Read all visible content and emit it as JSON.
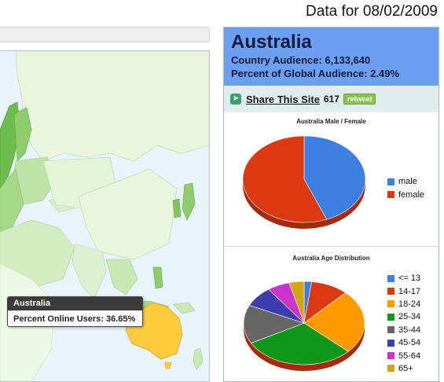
{
  "header": {
    "date_label": "Data for 08/02/2009"
  },
  "map": {
    "tooltip": {
      "title": "Australia",
      "value_label": "Percent Online Users: 36.65%"
    }
  },
  "panel": {
    "country": "Australia",
    "audience_line": "Country Audience: 6,133,640",
    "percent_line": "Percent of Global Audience: 2.49%",
    "share_label": "Share This Site",
    "share_count": "617",
    "retweet_label": "retweet"
  },
  "chart_data": [
    {
      "type": "pie",
      "title": "Australia Male / Female",
      "categories": [
        "male",
        "female"
      ],
      "values": [
        44,
        56
      ],
      "colors": [
        "#3d7fe0",
        "#dc3912"
      ],
      "legend": "right"
    },
    {
      "type": "pie",
      "title": "Australia Age Distribution",
      "categories": [
        "<= 13",
        "14-17",
        "18-24",
        "25-34",
        "35-44",
        "45-54",
        "55-64",
        "65+"
      ],
      "values": [
        2,
        10,
        25,
        30,
        15,
        8,
        6,
        4
      ],
      "colors": [
        "#3d7fe0",
        "#dc3912",
        "#ff9900",
        "#109618",
        "#666666",
        "#3b3eac",
        "#cc33cc",
        "#d4a513"
      ],
      "legend": "right"
    }
  ]
}
